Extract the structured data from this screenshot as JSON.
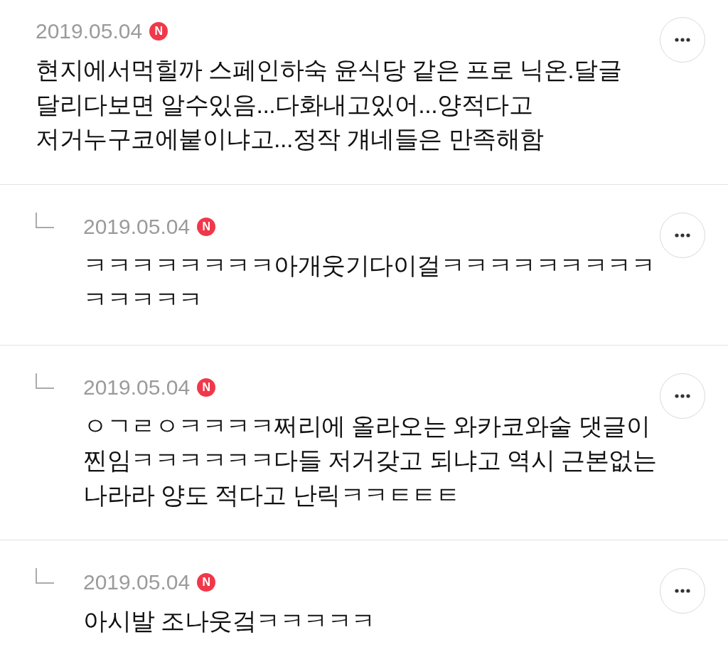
{
  "comments": [
    {
      "kind": "comment",
      "date": "2019.05.04",
      "badge": "N",
      "text": "현지에서먹힐까 스페인하숙 윤식당 같은 프로 닉온.달글 달리다보면 알수있음...다화내고있어...양적다고 저거누구코에붙이냐고...정작 걔네들은 만족해함"
    },
    {
      "kind": "reply",
      "date": "2019.05.04",
      "badge": "N",
      "text": "ㅋㅋㅋㅋㅋㅋㅋㅋ아개웃기다이걸ㅋㅋㅋㅋㅋㅋㅋㅋㅋㅋㅋㅋㅋㅋ"
    },
    {
      "kind": "reply",
      "date": "2019.05.04",
      "badge": "N",
      "text": "ㅇㄱㄹㅇㅋㅋㅋㅋ쩌리에 올라오는 와카코와술 댓글이 찐임ㅋㅋㅋㅋㅋㅋ다들 저거갖고 되냐고 역시 근본없는 나라라 양도 적다고 난릭ㅋㅋㅌㅌㅌ"
    },
    {
      "kind": "reply",
      "date": "2019.05.04",
      "badge": "N",
      "text": "아시발 조나웃겈ㅋㅋㅋㅋㅋ"
    }
  ]
}
